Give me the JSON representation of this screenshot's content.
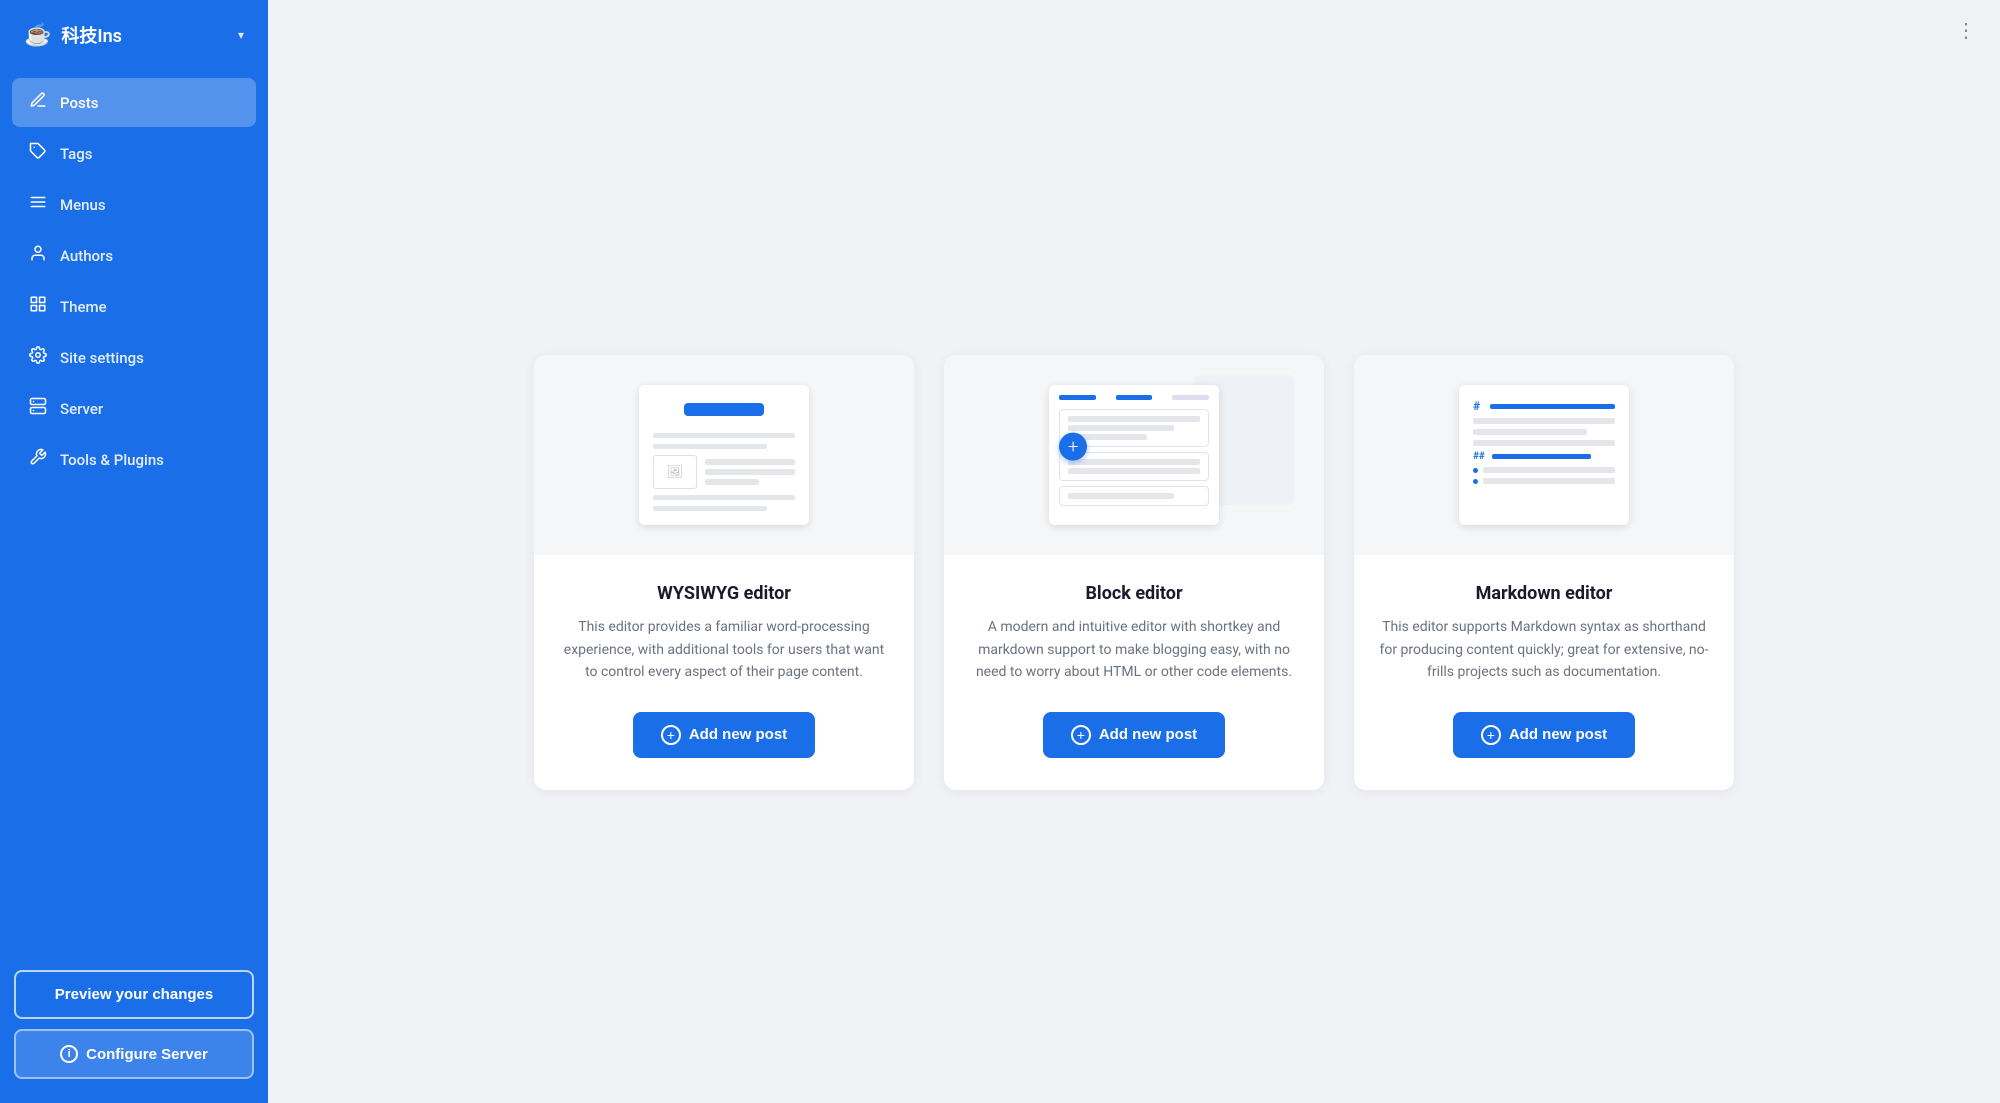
{
  "sidebar": {
    "title": "科技Ins",
    "dropdown_icon": "▾",
    "items": [
      {
        "id": "posts",
        "label": "Posts",
        "icon": "✏️",
        "active": true
      },
      {
        "id": "tags",
        "label": "Tags",
        "icon": "🏷️",
        "active": false
      },
      {
        "id": "menus",
        "label": "Menus",
        "icon": "☰",
        "active": false
      },
      {
        "id": "authors",
        "label": "Authors",
        "icon": "👤",
        "active": false
      },
      {
        "id": "theme",
        "label": "Theme",
        "icon": "⊞",
        "active": false
      },
      {
        "id": "site-settings",
        "label": "Site settings",
        "icon": "⚙️",
        "active": false
      },
      {
        "id": "server",
        "label": "Server",
        "icon": "▤",
        "active": false
      },
      {
        "id": "tools",
        "label": "Tools & Plugins",
        "icon": "🔧",
        "active": false
      }
    ],
    "preview_button": "Preview your changes",
    "configure_button": "Configure Server"
  },
  "main": {
    "more_icon": "⋮",
    "editors": [
      {
        "id": "wysiwyg",
        "title": "WYSIWYG editor",
        "description": "This editor provides a familiar word-processing experience, with additional tools for users that want to control every aspect of their page content.",
        "button_label": "Add new post"
      },
      {
        "id": "block",
        "title": "Block editor",
        "description": "A modern and intuitive editor with shortkey and markdown support to make blogging easy, with no need to worry about HTML or other code elements.",
        "button_label": "Add new post"
      },
      {
        "id": "markdown",
        "title": "Markdown editor",
        "description": "This editor supports Markdown syntax as shorthand for producing content quickly; great for extensive, no-frills projects such as documentation.",
        "button_label": "Add new post"
      }
    ]
  },
  "colors": {
    "sidebar_bg": "#1a6fe8",
    "accent": "#1a6fe8",
    "main_bg": "#f0f2f5"
  }
}
